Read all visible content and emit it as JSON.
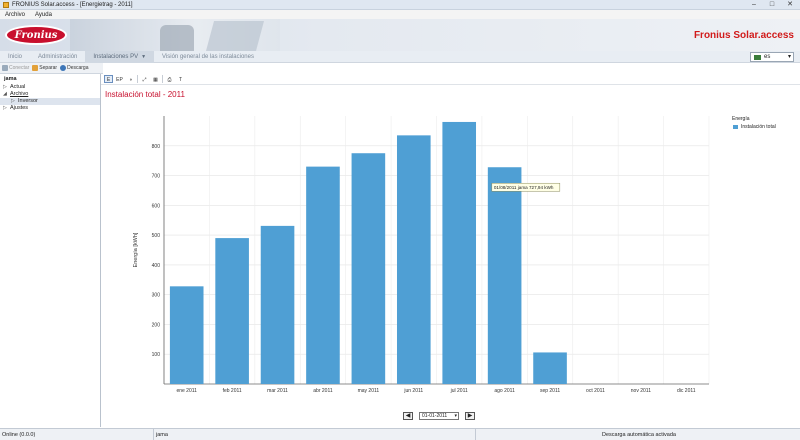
{
  "window": {
    "title": "FRONIUS Solar.access - [Energietrag - 2011]",
    "controls": [
      "–",
      "□",
      "✕"
    ]
  },
  "menubar": {
    "items": [
      "Archivo",
      "Ayuda"
    ]
  },
  "banner": {
    "logo_text": "Fronius",
    "brand_title": "Fronius Solar.access"
  },
  "navbar": {
    "items": [
      "Inicio",
      "Administración",
      "Instalaciones PV",
      "Visión general de las instalaciones"
    ],
    "language": "es"
  },
  "toolbar": {
    "connect": "Conectar",
    "separate": "Separar",
    "download": "Descarga"
  },
  "sidebar": {
    "root": "jama",
    "items": [
      "Actual",
      "Archivo",
      "Inversor",
      "Ajustes"
    ]
  },
  "chart_toolbar": {
    "buttons": [
      "E",
      "EP",
      "◑",
      "⤢",
      "▦",
      "⎙",
      "T"
    ]
  },
  "chart_title": "Instalación total - 2011",
  "chart_data": {
    "type": "bar",
    "categories": [
      "ene 2011",
      "feb 2011",
      "mar 2011",
      "abr 2011",
      "may 2011",
      "jun 2011",
      "jul 2011",
      "ago 2011",
      "sep 2011",
      "oct 2011",
      "nov 2011",
      "dic 2011"
    ],
    "values": [
      328,
      490,
      531,
      730,
      775,
      835,
      880,
      727.94,
      106,
      0,
      0,
      0
    ],
    "ylabel": "Energía [kWh]",
    "yticks": [
      100,
      200,
      300,
      400,
      500,
      600,
      700,
      800
    ],
    "ylim": [
      0,
      900
    ],
    "grid": true,
    "legend_title": "Energía",
    "series_name": "Instalación total",
    "bar_color": "#4f9fd4",
    "tooltip": "01/08/2011 jama 727,94 kWh",
    "tooltip_index": 7
  },
  "pager": {
    "prev": "◀",
    "date": "01-01-2011",
    "next": "▶"
  },
  "statusbar": {
    "connection": "Online (0.0.0)",
    "system": "jama",
    "download_status": "Descarga automática activada"
  }
}
